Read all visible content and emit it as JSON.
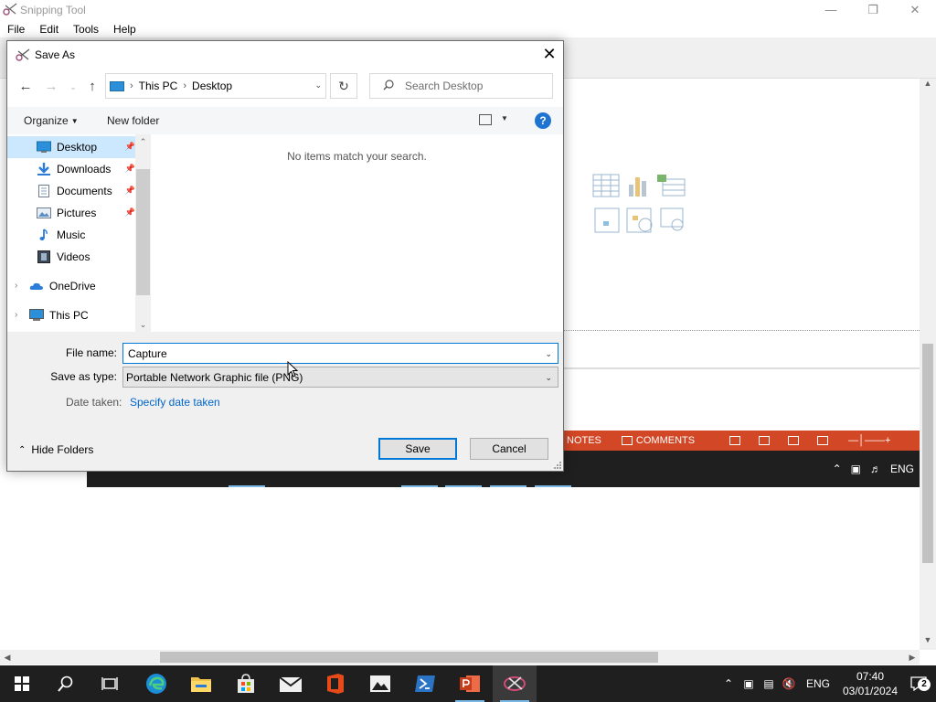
{
  "snipping_tool": {
    "title": "Snipping Tool",
    "menu": [
      "File",
      "Edit",
      "Tools",
      "Help"
    ],
    "captured": {
      "statusbar": {
        "notes": "NOTES",
        "comments": "COMMENTS"
      },
      "taskbar_lang": "ENG"
    }
  },
  "dialog": {
    "title": "Save As",
    "breadcrumb": [
      "This PC",
      "Desktop"
    ],
    "search_placeholder": "Search Desktop",
    "commands": {
      "organize": "Organize",
      "new_folder": "New folder",
      "help": "?"
    },
    "nav": {
      "quick_access": [
        {
          "label": "Desktop",
          "icon": "desktop-icon",
          "pinned": true,
          "selected": true
        },
        {
          "label": "Downloads",
          "icon": "download-icon",
          "pinned": true
        },
        {
          "label": "Documents",
          "icon": "document-icon",
          "pinned": true
        },
        {
          "label": "Pictures",
          "icon": "pictures-icon",
          "pinned": true
        },
        {
          "label": "Music",
          "icon": "music-icon"
        },
        {
          "label": "Videos",
          "icon": "videos-icon"
        }
      ],
      "onedrive": "OneDrive",
      "this_pc": "This PC"
    },
    "empty_message": "No items match your search.",
    "file_name_label": "File name:",
    "file_name_value": "Capture",
    "save_type_label": "Save as type:",
    "save_type_value": "Portable Network Graphic file (PNG)",
    "date_taken_label": "Date taken:",
    "date_taken_link": "Specify date taken",
    "hide_folders": "Hide Folders",
    "save_button": "Save",
    "cancel_button": "Cancel"
  },
  "taskbar": {
    "lang": "ENG",
    "time": "07:40",
    "date": "03/01/2024",
    "notification_count": "2"
  },
  "colors": {
    "accent": "#0078d7",
    "link": "#0066cc",
    "powerpoint_red": "#d24726",
    "taskbar": "#1f1f1f"
  }
}
